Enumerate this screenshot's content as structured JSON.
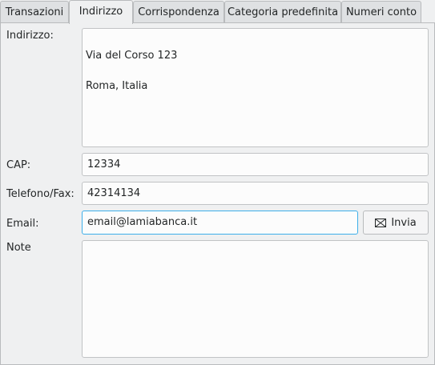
{
  "tabs": [
    {
      "label": "Transazioni"
    },
    {
      "label": "Indirizzo"
    },
    {
      "label": "Corrispondenza"
    },
    {
      "label": "Categoria predefinita"
    },
    {
      "label": "Numeri conto"
    }
  ],
  "active_tab": "Indirizzo",
  "form": {
    "address_label": "Indirizzo:",
    "address_lines": [
      "Via del Corso 123",
      "Roma, Italia"
    ],
    "cap_label": "CAP:",
    "cap_value": "12334",
    "phone_label": "Telefono/Fax:",
    "phone_value": "42314134",
    "email_label": "Email:",
    "email_value": "email@lamiabanca.it",
    "send_label": "Invia",
    "send_icon": "envelope-icon",
    "notes_label": "Note",
    "notes_value": ""
  },
  "colors": {
    "focus_border": "#3daee9"
  }
}
